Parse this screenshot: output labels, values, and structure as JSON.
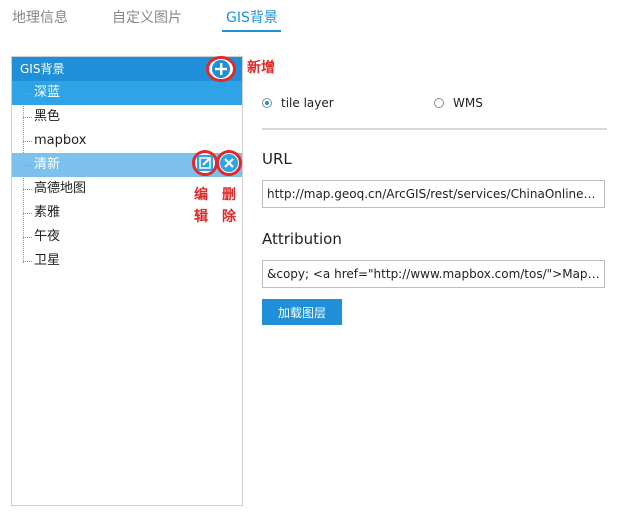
{
  "tabs": [
    "地理信息",
    "自定义图片",
    "GIS背景"
  ],
  "tree": {
    "header": "GIS背景",
    "items": [
      "深蓝",
      "黑色",
      "mapbox",
      "清新",
      "高德地图",
      "素雅",
      "午夜",
      "卫星"
    ]
  },
  "annotations": {
    "add": "新增",
    "edit": "编辑",
    "delete": "删除"
  },
  "layer_type": {
    "options": [
      "tile layer",
      "WMS"
    ],
    "selected": "tile layer"
  },
  "url": {
    "label": "URL",
    "value": "http://map.geoq.cn/ArcGIS/rest/services/ChinaOnlineStreetP..."
  },
  "attribution": {
    "label": "Attribution",
    "value": "&copy; <a href=\"http://www.mapbox.com/tos/\">Mapbox</..."
  },
  "load_button": "加载图层",
  "colors": {
    "accent": "#1e8fd8",
    "annotation": "#e02a2a"
  }
}
